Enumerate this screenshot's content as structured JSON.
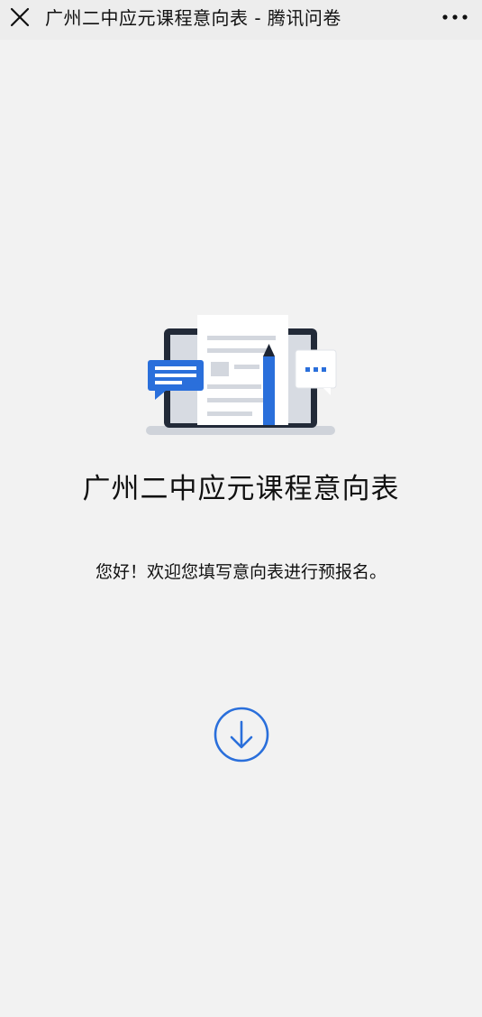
{
  "header": {
    "title": "广州二中应元课程意向表 - 腾讯问卷",
    "close_icon": "close-icon",
    "more_icon": "more-icon"
  },
  "main": {
    "illustration_icon": "survey-laptop-illustration",
    "survey_title": "广州二中应元课程意向表",
    "welcome_text": "您好！欢迎您填写意向表进行预报名。",
    "scroll_icon": "arrow-down-circle-icon"
  },
  "colors": {
    "accent": "#2a6fdb",
    "background": "#f2f2f2",
    "header_bg": "#ededed",
    "text": "#111111"
  }
}
